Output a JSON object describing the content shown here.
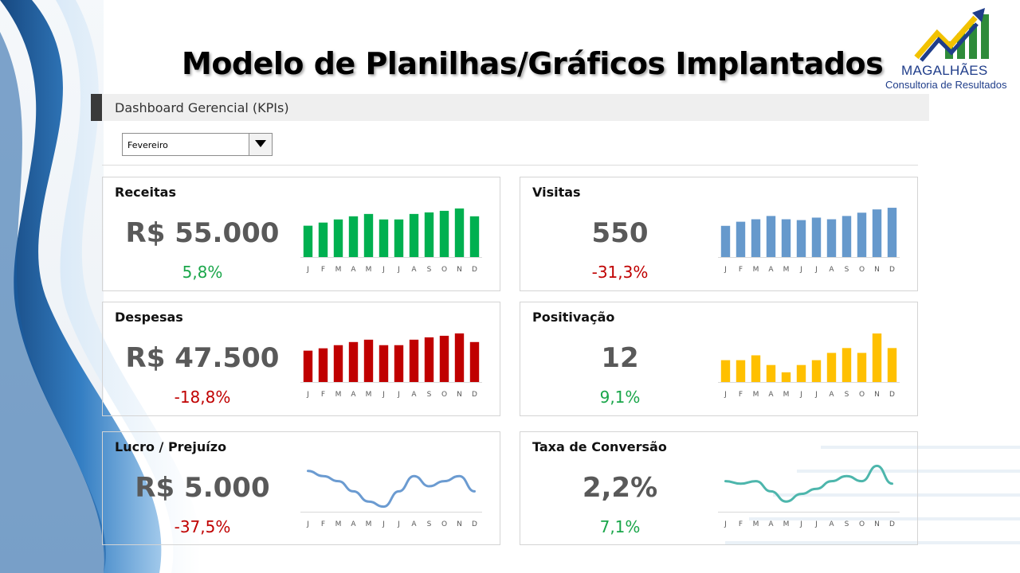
{
  "title": "Modelo de Planilhas/Gráficos Implantados",
  "logo": {
    "name": "MAGALHÃES",
    "tagline": "Consultoria de Resultados"
  },
  "header": {
    "label": "Dashboard Gerencial (KPIs)"
  },
  "month_select": {
    "value": "Fevereiro"
  },
  "months": [
    "J",
    "F",
    "M",
    "A",
    "M",
    "J",
    "J",
    "A",
    "S",
    "O",
    "N",
    "D"
  ],
  "colors": {
    "green": "#00b050",
    "blue": "#6699cc",
    "red": "#c00000",
    "yellow": "#ffc000",
    "line_blue": "#6b9bd1",
    "line_teal": "#4db6ac",
    "positive": "#1aa64a",
    "negative": "#c00000"
  },
  "cards": {
    "receitas": {
      "title": "Receitas",
      "value": "R$ 55.000",
      "change": "5,8%",
      "change_sign": "pos"
    },
    "visitas": {
      "title": "Visitas",
      "value": "550",
      "change": "-31,3%",
      "change_sign": "neg"
    },
    "despesas": {
      "title": "Despesas",
      "value": "R$ 47.500",
      "change": "-18,8%",
      "change_sign": "neg"
    },
    "positivacao": {
      "title": "Positivação",
      "value": "12",
      "change": "9,1%",
      "change_sign": "pos"
    },
    "lucro": {
      "title": "Lucro / Prejuízo",
      "value": "R$ 5.000",
      "change": "-37,5%",
      "change_sign": "neg"
    },
    "conversao": {
      "title": "Taxa de Conversão",
      "value": "2,2%",
      "change": "7,1%",
      "change_sign": "pos"
    }
  },
  "chart_data": [
    {
      "id": "receitas",
      "type": "bar",
      "categories": [
        "J",
        "F",
        "M",
        "A",
        "M",
        "J",
        "J",
        "A",
        "S",
        "O",
        "N",
        "D"
      ],
      "values": [
        40,
        44,
        48,
        52,
        55,
        48,
        48,
        55,
        57,
        59,
        62,
        52
      ],
      "ylim": [
        0,
        65
      ]
    },
    {
      "id": "visitas",
      "type": "bar",
      "categories": [
        "J",
        "F",
        "M",
        "A",
        "M",
        "J",
        "J",
        "A",
        "S",
        "O",
        "N",
        "D"
      ],
      "values": [
        380,
        430,
        460,
        500,
        460,
        450,
        480,
        460,
        500,
        540,
        580,
        600
      ],
      "ylim": [
        0,
        620
      ]
    },
    {
      "id": "despesas",
      "type": "bar",
      "categories": [
        "J",
        "F",
        "M",
        "A",
        "M",
        "J",
        "J",
        "A",
        "S",
        "O",
        "N",
        "D"
      ],
      "values": [
        40,
        43,
        47,
        51,
        54,
        47,
        47,
        54,
        57,
        59,
        62,
        51
      ],
      "ylim": [
        0,
        65
      ]
    },
    {
      "id": "positivacao",
      "type": "bar",
      "categories": [
        "J",
        "F",
        "M",
        "A",
        "M",
        "J",
        "J",
        "A",
        "S",
        "O",
        "N",
        "D"
      ],
      "values": [
        9,
        9,
        11,
        7,
        4,
        7,
        9,
        12,
        14,
        12,
        20,
        14
      ],
      "ylim": [
        0,
        21
      ]
    },
    {
      "id": "lucro",
      "type": "line",
      "categories": [
        "J",
        "F",
        "M",
        "A",
        "M",
        "J",
        "J",
        "A",
        "S",
        "O",
        "N",
        "D"
      ],
      "values": [
        6,
        5,
        4,
        2,
        0,
        -1,
        2,
        5,
        3,
        4,
        5,
        2
      ],
      "ylim": [
        -2,
        8
      ]
    },
    {
      "id": "conversao",
      "type": "line",
      "categories": [
        "J",
        "F",
        "M",
        "A",
        "M",
        "J",
        "J",
        "A",
        "S",
        "O",
        "N",
        "D"
      ],
      "values": [
        2.2,
        2.1,
        2.2,
        1.8,
        1.4,
        1.7,
        1.9,
        2.2,
        2.4,
        2.2,
        2.8,
        2.1
      ],
      "ylim": [
        1.0,
        3.0
      ]
    }
  ]
}
